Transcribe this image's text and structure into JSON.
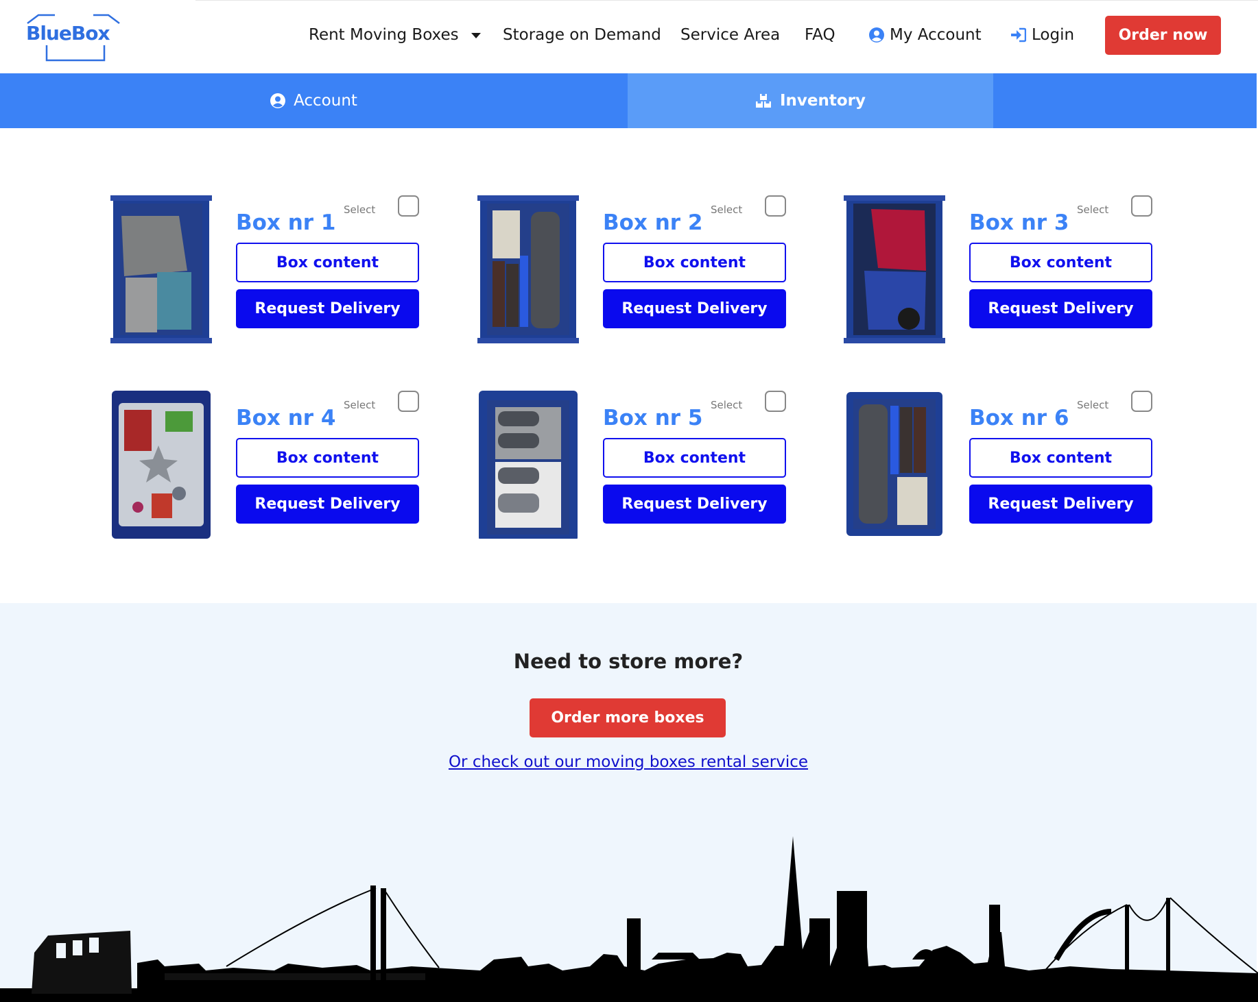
{
  "header": {
    "logo_text": "BlueBox",
    "nav": {
      "rent": "Rent Moving Boxes",
      "storage": "Storage on Demand",
      "service_area": "Service Area",
      "faq": "FAQ",
      "account": "My Account",
      "login": "Login"
    },
    "order_now": "Order now"
  },
  "tabs": {
    "account": "Account",
    "inventory": "Inventory",
    "active": "inventory"
  },
  "boxes": [
    {
      "title": "Box nr 1",
      "select": "Select",
      "content_btn": "Box content",
      "delivery_btn": "Request Delivery"
    },
    {
      "title": "Box nr 2",
      "select": "Select",
      "content_btn": "Box content",
      "delivery_btn": "Request Delivery"
    },
    {
      "title": "Box nr 3",
      "select": "Select",
      "content_btn": "Box content",
      "delivery_btn": "Request Delivery"
    },
    {
      "title": "Box nr 4",
      "select": "Select",
      "content_btn": "Box content",
      "delivery_btn": "Request Delivery"
    },
    {
      "title": "Box nr 5",
      "select": "Select",
      "content_btn": "Box content",
      "delivery_btn": "Request Delivery"
    },
    {
      "title": "Box nr 6",
      "select": "Select",
      "content_btn": "Box content",
      "delivery_btn": "Request Delivery"
    }
  ],
  "promo": {
    "title": "Need to store more?",
    "button": "Order more boxes",
    "link": "Or check out our moving boxes rental service"
  },
  "colors": {
    "brand_blue": "#3b82f6",
    "button_blue": "#0a0aee",
    "accent_red": "#e03a34",
    "promo_bg": "#eff6fd"
  },
  "icons": {
    "dropdown": "caret-down-icon",
    "account": "user-circle-icon",
    "login": "sign-in-icon",
    "inventory": "boxes-icon"
  }
}
